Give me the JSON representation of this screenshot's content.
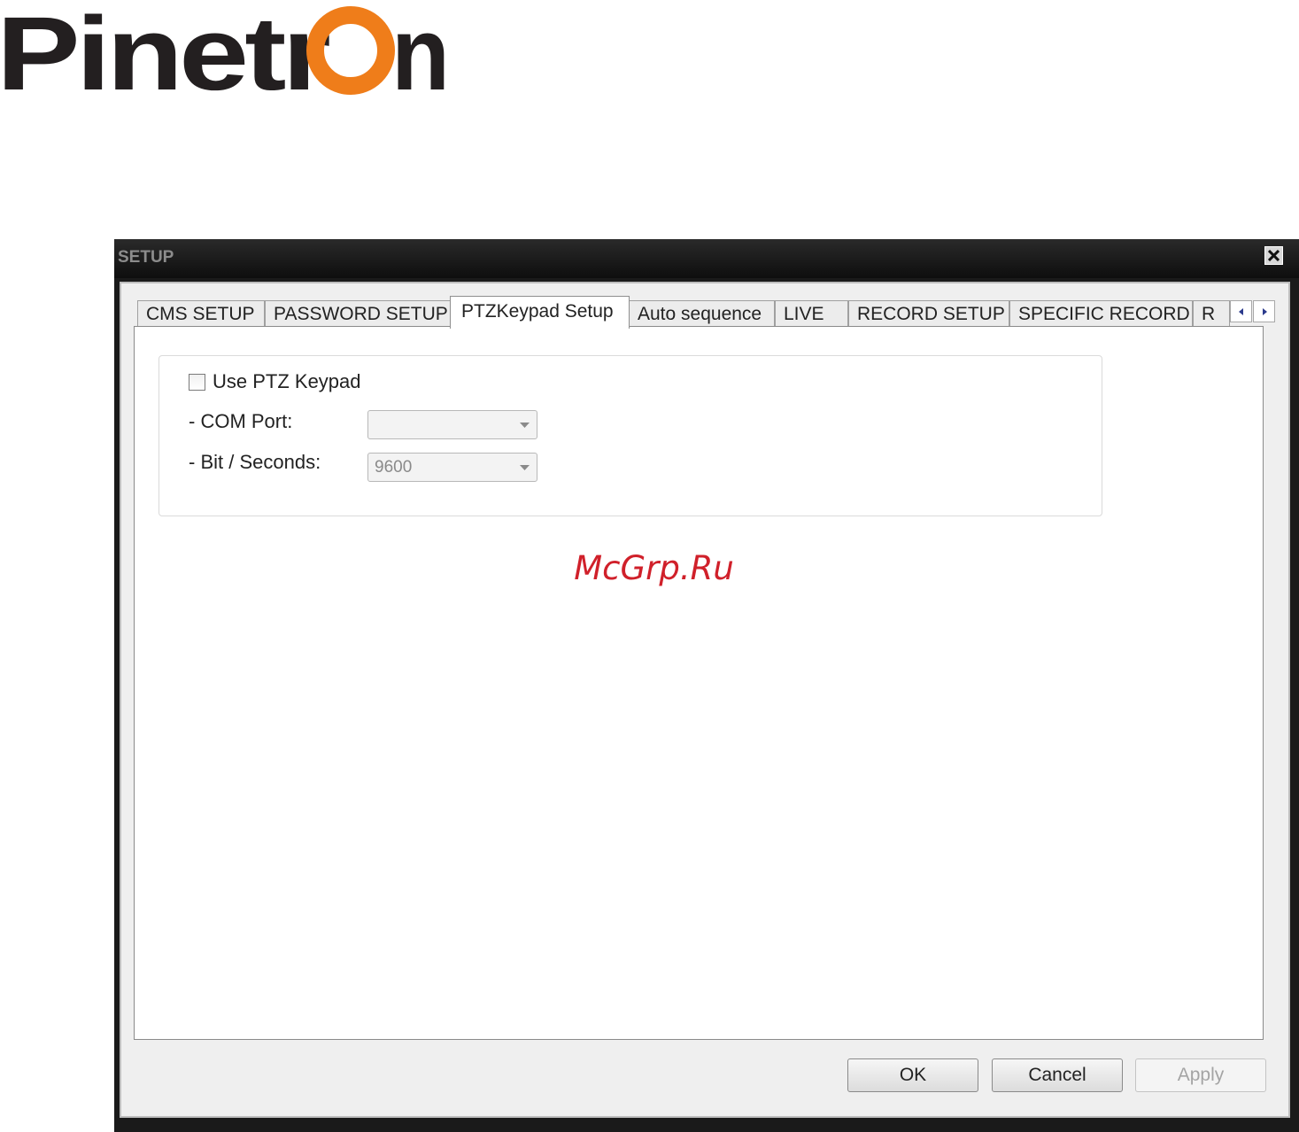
{
  "logo": {
    "text_dark": "Pinetr",
    "text_ring": "O",
    "text_end": "n",
    "colors": {
      "dark": "#231f20",
      "ring": "#ef7d1a"
    }
  },
  "window": {
    "title": "SETUP",
    "close_icon": "close-icon"
  },
  "tabs": [
    {
      "label": "CMS SETUP",
      "active": false
    },
    {
      "label": "PASSWORD SETUP",
      "active": false
    },
    {
      "label": "PTZKeypad Setup",
      "active": true
    },
    {
      "label": "Auto sequence",
      "active": false
    },
    {
      "label": "LIVE",
      "active": false
    },
    {
      "label": "RECORD SETUP",
      "active": false
    },
    {
      "label": "SPECIFIC RECORD",
      "active": false
    },
    {
      "label": "R",
      "active": false
    }
  ],
  "tab_scroll": {
    "left_icon": "arrow-left-icon",
    "right_icon": "arrow-right-icon"
  },
  "ptz": {
    "use_keypad_label": "Use PTZ Keypad",
    "use_keypad_checked": false,
    "com_port_label": "- COM Port:",
    "com_port_value": "",
    "bit_seconds_label": "- Bit / Seconds:",
    "bit_seconds_value": "9600"
  },
  "watermark": "McGrp.Ru",
  "buttons": {
    "ok": "OK",
    "cancel": "Cancel",
    "apply": "Apply"
  }
}
